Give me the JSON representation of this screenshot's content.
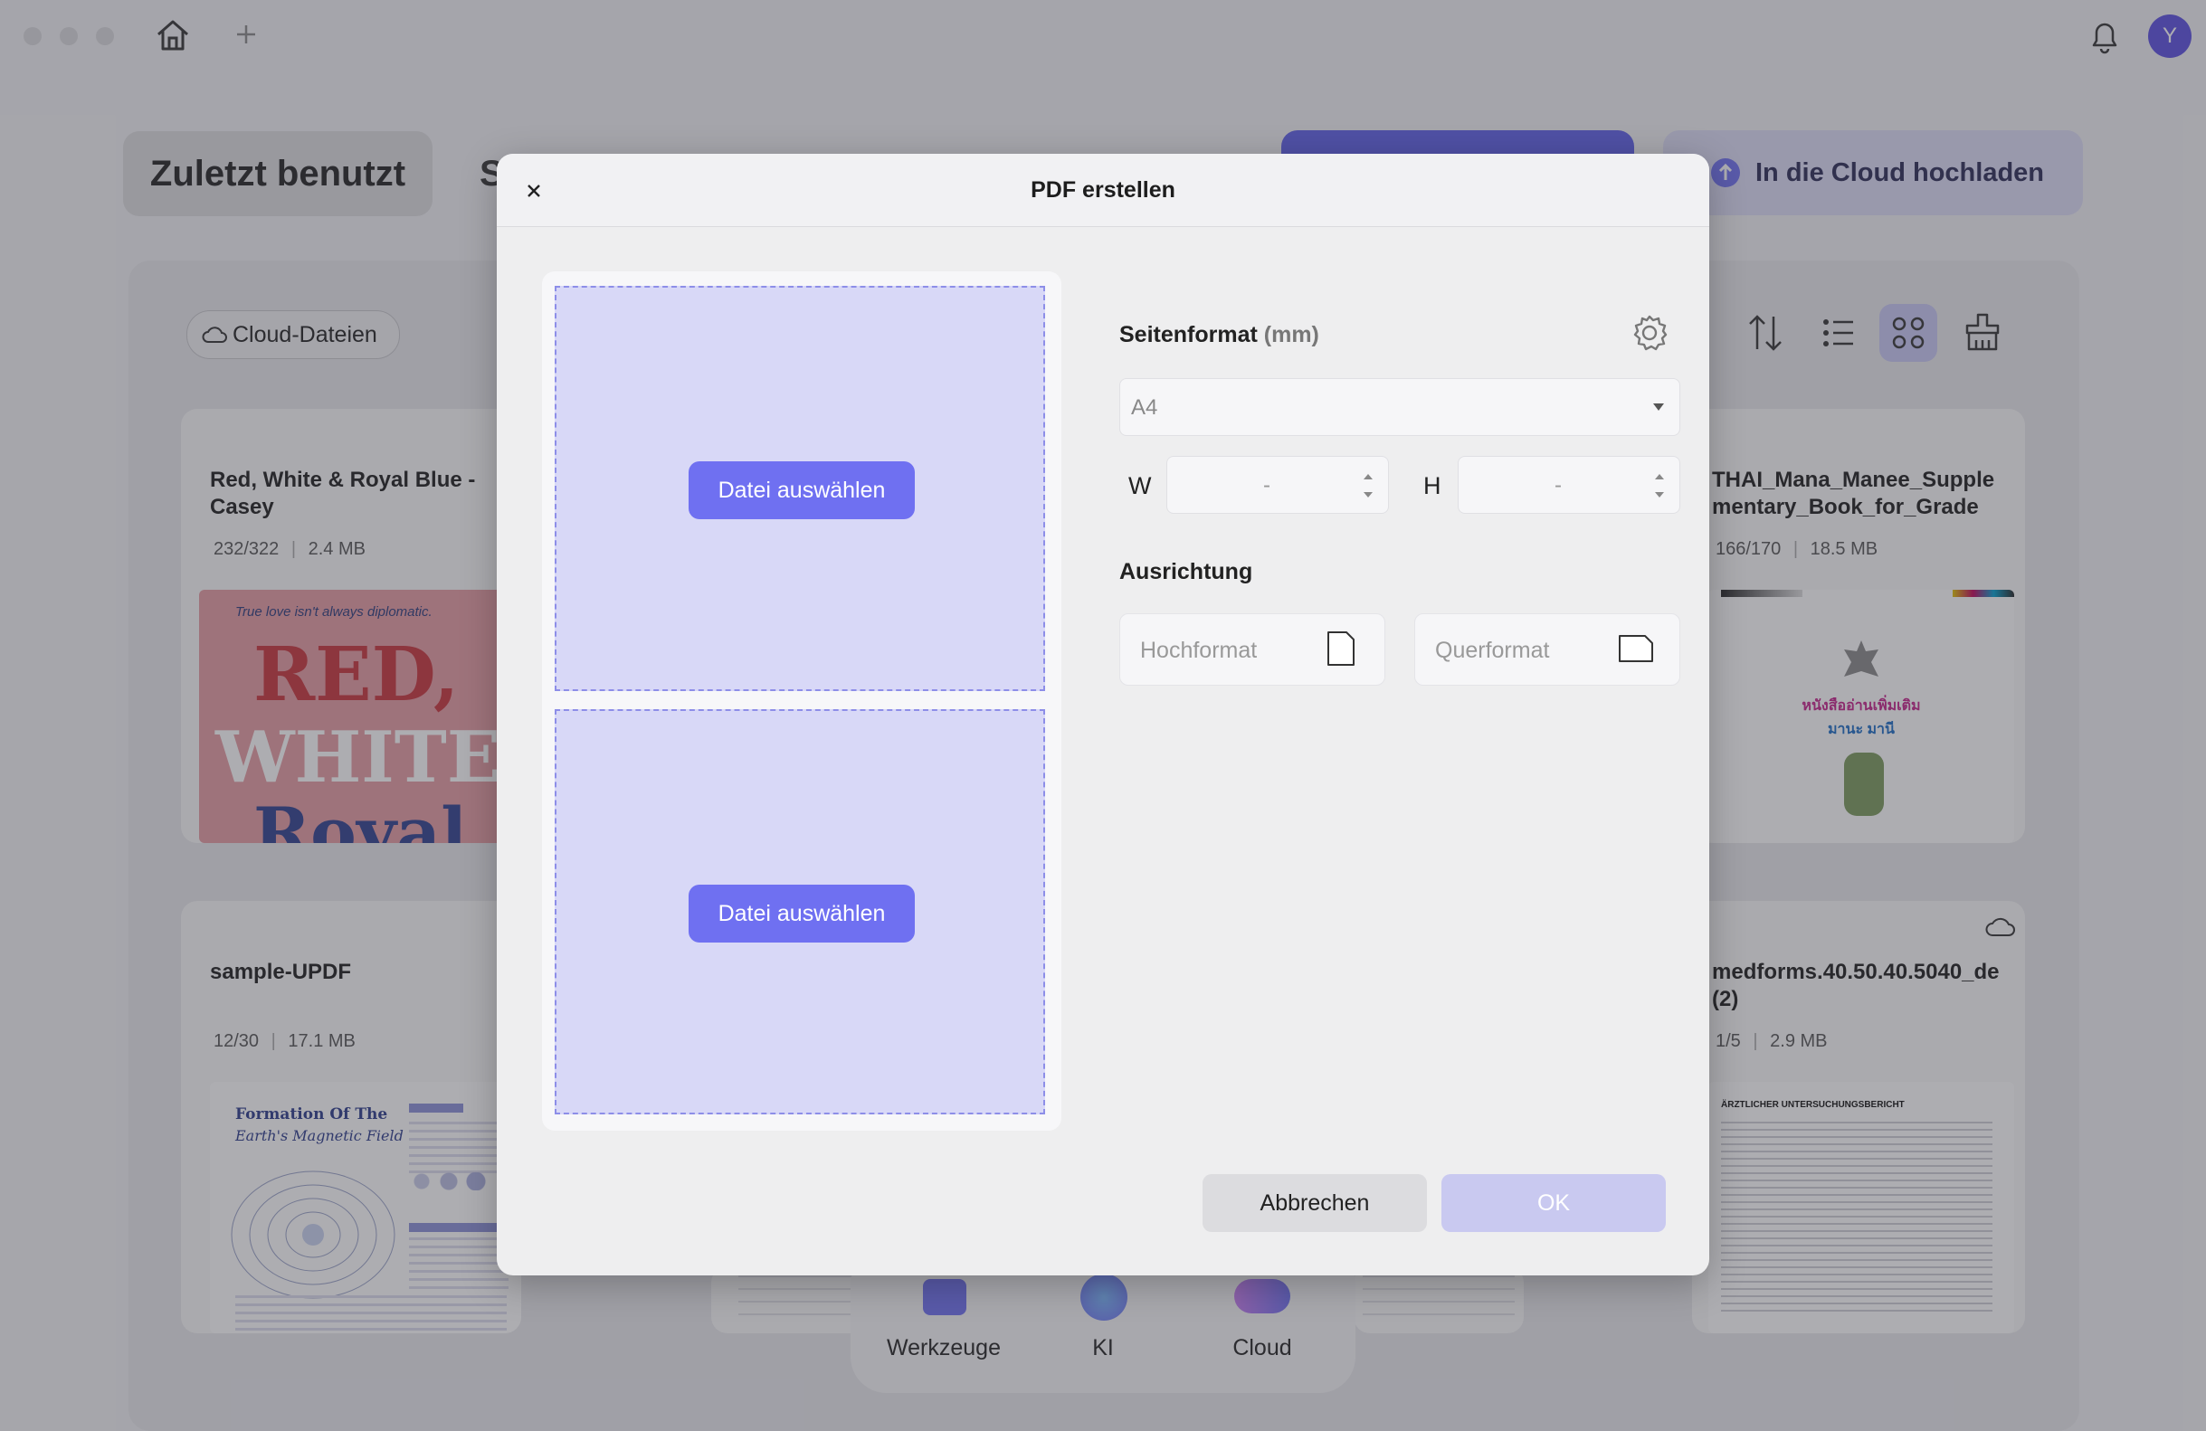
{
  "app": {
    "tabs": {
      "recent": "Zuletzt benutzt",
      "second": "S"
    },
    "upload_button": "In die Cloud hochladen",
    "cloud_files_chip": "Cloud-Dateien",
    "avatar_initial": "Y",
    "cards": [
      {
        "title": "Red, White & Royal Blue - Casey",
        "pages": "232/322",
        "size": "2.4 MB",
        "cover": {
          "tagline": "True love isn't always diplomatic.",
          "line1": "RED,",
          "line2": "WHITE",
          "line3": "Royal"
        }
      },
      {
        "title": "THAI_Mana_Manee_Supplementary_Book_for_Grade",
        "pages": "166/170",
        "size": "18.5 MB",
        "cover": {
          "line1": "หนังสืออ่านเพิ่มเติม",
          "line2": "มานะ มานี"
        }
      },
      {
        "title": "sample-UPDF",
        "pages": "12/30",
        "size": "17.1 MB",
        "cover": {
          "title1": "Formation Of The",
          "title2": "Earth's Magnetic Field"
        }
      },
      {
        "title": "medforms.40.50.40.5040_de(2)",
        "pages": "1/5",
        "size": "2.9 MB",
        "cover": {
          "heading": "ÄRZTLICHER UNTERSUCHUNGSBERICHT"
        }
      }
    ],
    "dock": {
      "tools": "Werkzeuge",
      "ai": "KI",
      "cloud": "Cloud"
    }
  },
  "dialog": {
    "title": "PDF erstellen",
    "select_file_label": "Datei auswählen",
    "page_format_label": "Seitenformat",
    "page_format_unit": "(mm)",
    "page_format_value": "A4",
    "width_label": "W",
    "height_label": "H",
    "width_value": "-",
    "height_value": "-",
    "orientation_label": "Ausrichtung",
    "portrait_label": "Hochformat",
    "landscape_label": "Querformat",
    "cancel_label": "Abbrechen",
    "ok_label": "OK"
  },
  "colors": {
    "accent": "#6f70f1",
    "drop_zone": "#d8d8f7",
    "ok_disabled": "#c9c9f0",
    "overlay": "#3c3c46"
  }
}
